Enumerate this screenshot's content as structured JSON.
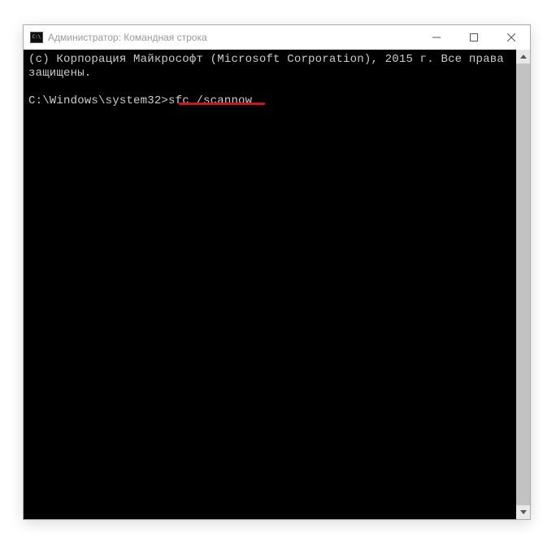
{
  "window": {
    "title": "Администратор: Командная строка"
  },
  "console": {
    "copyright_line1": "(с) Корпорация Майкрософт (Microsoft Corporation), 2015 г. Все права защищены.",
    "blank": "",
    "prompt": "C:\\Windows\\system32>",
    "command": "sfc /scannow"
  }
}
